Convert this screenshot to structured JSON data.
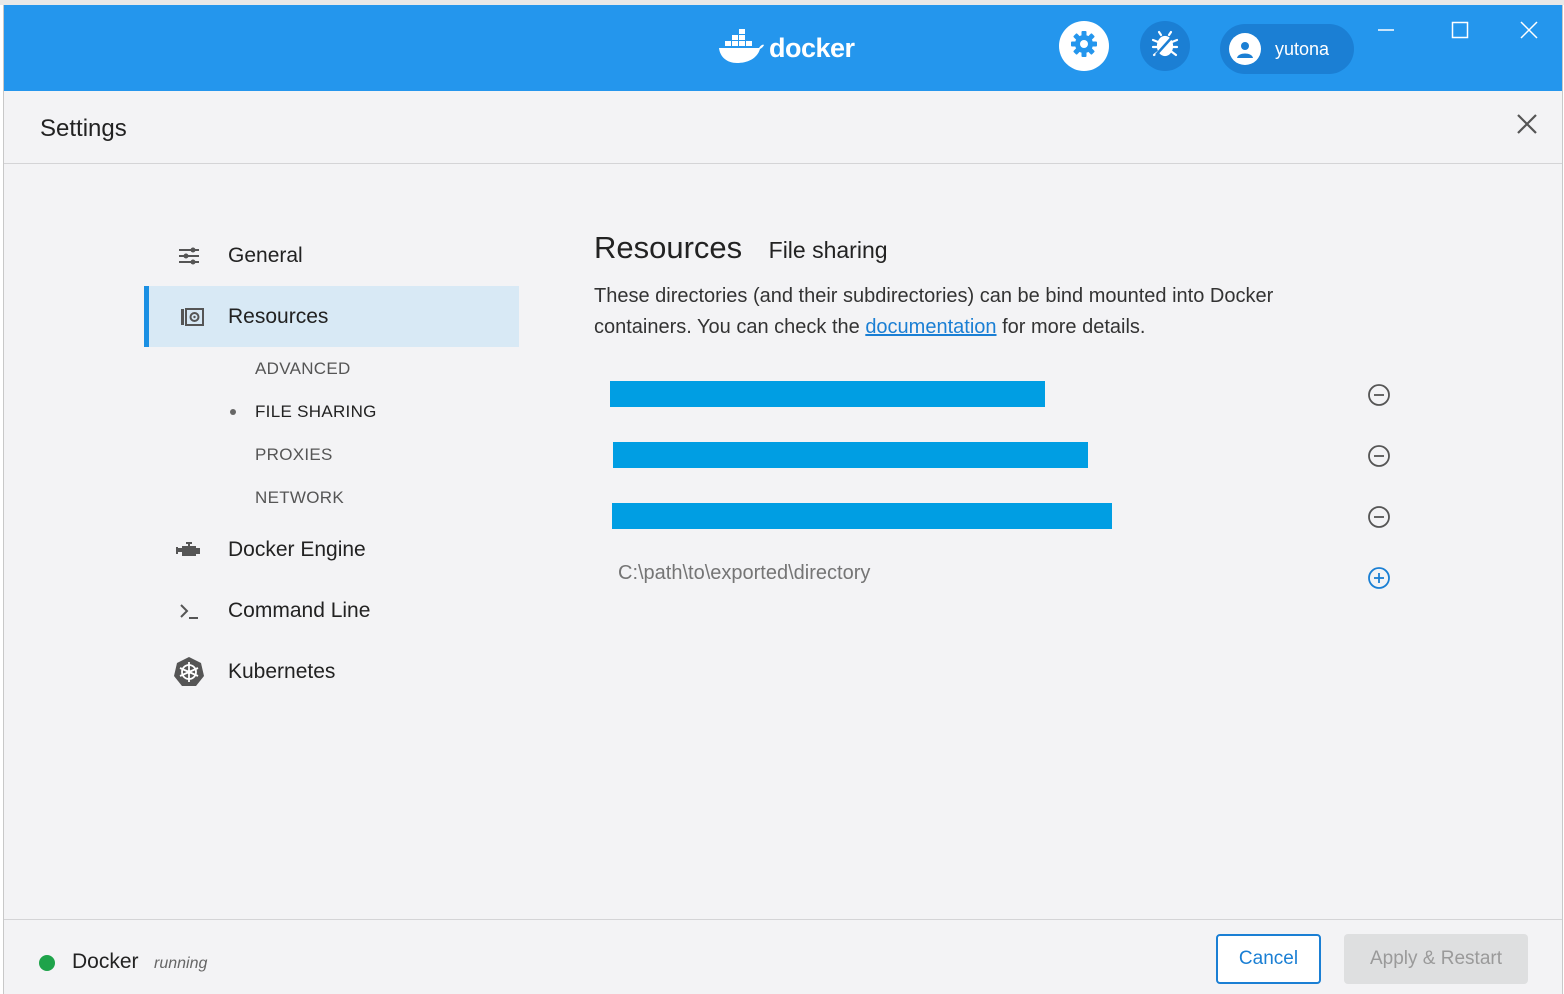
{
  "titlebar": {
    "logo_text": "docker",
    "user_name": "yutona",
    "colors": {
      "bar": "#2496ed",
      "accent": "#1a7fd4"
    }
  },
  "settings": {
    "title": "Settings"
  },
  "nav": {
    "general": "General",
    "resources": "Resources",
    "sub": {
      "advanced": "ADVANCED",
      "file_sharing": "FILE SHARING",
      "proxies": "PROXIES",
      "network": "NETWORK"
    },
    "docker_engine": "Docker Engine",
    "command_line": "Command Line",
    "kubernetes": "Kubernetes"
  },
  "content": {
    "heading": "Resources",
    "subheading": "File sharing",
    "desc_before": "These directories (and their subdirectories) can be bind mounted into Docker containers. You can check the ",
    "desc_link": "documentation",
    "desc_after": " for more details.",
    "new_dir_placeholder": "C:\\path\\to\\exported\\directory"
  },
  "footer": {
    "app_name": "Docker",
    "state": "running",
    "cancel_label": "Cancel",
    "apply_label": "Apply & Restart"
  }
}
